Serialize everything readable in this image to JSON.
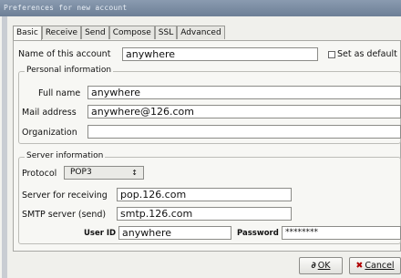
{
  "window": {
    "title": "Preferences for new account"
  },
  "tabs": [
    "Basic",
    "Receive",
    "Send",
    "Compose",
    "SSL",
    "Advanced"
  ],
  "account": {
    "name_label": "Name of this account",
    "name_value": "anywhere",
    "default_label": "Set as default"
  },
  "personal": {
    "group_label": "Personal information",
    "fullname_label": "Full name",
    "fullname_value": "anywhere",
    "mail_label": "Mail address",
    "mail_value": "anywhere@126.com",
    "org_label": "Organization",
    "org_value": ""
  },
  "server": {
    "group_label": "Server information",
    "protocol_label": "Protocol",
    "protocol_value": "POP3",
    "protocol_arrow": "↕",
    "receiving_label": "Server for receiving",
    "receiving_value": "pop.126.com",
    "smtp_label": "SMTP server (send)",
    "smtp_value": "smtp.126.com",
    "userid_label": "User ID",
    "userid_value": "anywhere",
    "password_label": "Password",
    "password_value": "********"
  },
  "buttons": {
    "ok_icon": "∂",
    "ok_label": "OK",
    "cancel_icon": "✖",
    "cancel_label": "Cancel"
  }
}
